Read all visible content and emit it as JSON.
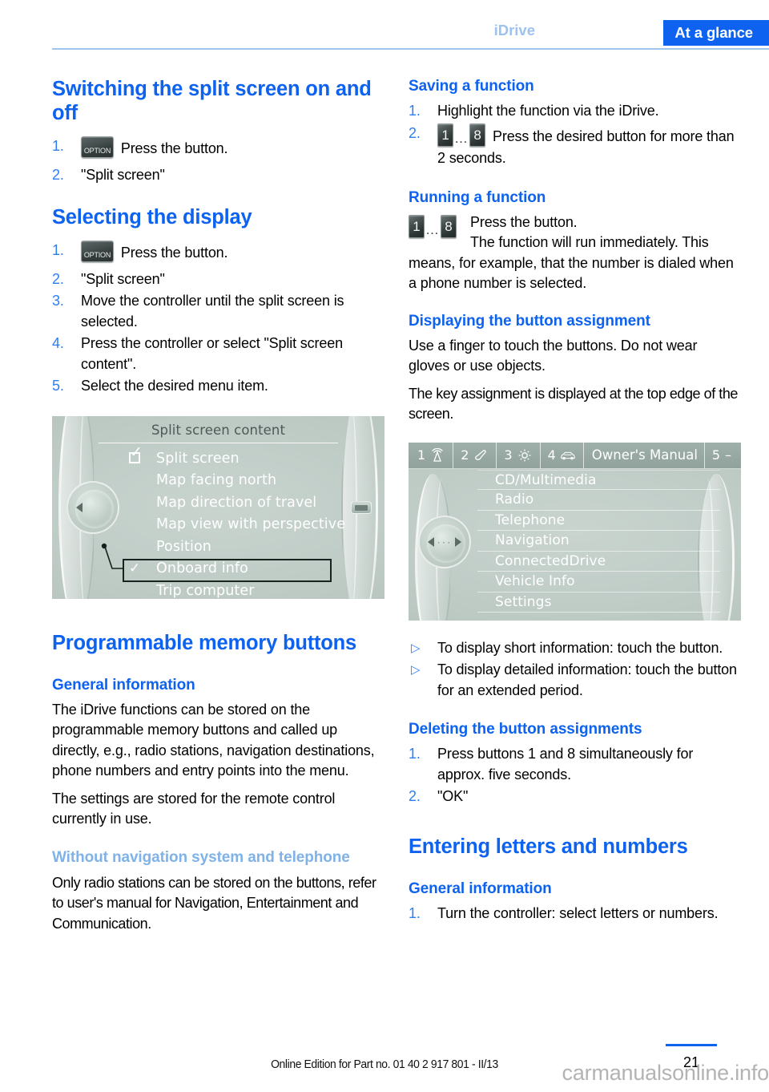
{
  "header": {
    "breadcrumb_left": "iDrive",
    "breadcrumb_active": "At a glance",
    "accent_blue": "#0d62ef",
    "light_blue": "#9cc2f2"
  },
  "left_column": {
    "section1_title": "Switching the split screen on and off",
    "section1_steps": [
      {
        "num": "1.",
        "icon": "option-button",
        "icon_label": "OPTION",
        "text": "Press the button."
      },
      {
        "num": "2.",
        "text": "\"Split screen\""
      }
    ],
    "section2_title": "Selecting the display",
    "section2_steps": [
      {
        "num": "1.",
        "icon": "option-button",
        "icon_label": "OPTION",
        "text": "Press the button."
      },
      {
        "num": "2.",
        "text": "\"Split screen\""
      },
      {
        "num": "3.",
        "text": "Move the controller until the split screen is selected."
      },
      {
        "num": "4.",
        "text": "Press the controller or select \"Split screen content\"."
      },
      {
        "num": "5.",
        "text": "Select the desired menu item."
      }
    ],
    "screenshot1": {
      "title": "Split screen content",
      "items": [
        {
          "label": "Split screen",
          "marker": "checkbox-checked"
        },
        {
          "label": "Map facing north",
          "marker": "none"
        },
        {
          "label": "Map direction of travel",
          "marker": "none"
        },
        {
          "label": "Map view with perspective",
          "marker": "none"
        },
        {
          "label": "Position",
          "marker": "none"
        },
        {
          "label": "Onboard info",
          "marker": "check",
          "selected": true
        },
        {
          "label": "Trip computer",
          "marker": "none"
        }
      ]
    },
    "section3_title": "Programmable memory buttons",
    "section3_sub1": "General information",
    "section3_p1": "The iDrive functions can be stored on the programmable memory buttons and called up directly, e.g., radio stations, navigation destinations, phone numbers and entry points into the menu.",
    "section3_p2": "The settings are stored for the remote control currently in use.",
    "section3_sub2": "Without navigation system and telephone",
    "section3_p3": "Only radio stations can be stored on the buttons, refer to user's manual for Navigation, Entertainment and Communication."
  },
  "right_column": {
    "section4_title": "Saving a function",
    "section4_steps": [
      {
        "num": "1.",
        "text": "Highlight the function via the iDrive."
      },
      {
        "num": "2.",
        "icon": "memory-buttons",
        "btn_from": "1",
        "btn_to": "8",
        "dots": "…",
        "text": "Press the desired button for more than 2 seconds."
      }
    ],
    "section5_title": "Running a function",
    "section5_btn_from": "1",
    "section5_btn_to": "8",
    "section5_dots": "…",
    "section5_line1": "Press the button.",
    "section5_line2": "The function will run immediately. This",
    "section5_rest": "means, for example, that the number is dialed when a phone number is selected.",
    "section6_title": "Displaying the button assignment",
    "section6_p1": "Use a finger to touch the buttons. Do not wear gloves or use objects.",
    "section6_p2": "The key assignment is displayed at the top edge of the screen.",
    "screenshot2": {
      "topbar": [
        {
          "num": "1",
          "icon": "antenna-icon"
        },
        {
          "num": "2",
          "icon": "phone-icon"
        },
        {
          "num": "3",
          "icon": "gear-icon"
        },
        {
          "num": "4",
          "icon": "car-icon"
        }
      ],
      "topbar_title": "Owner's Manual",
      "topbar_right_num": "5",
      "topbar_right_sym": "–",
      "rows": [
        "CD/Multimedia",
        "Radio",
        "Telephone",
        "Navigation",
        "ConnectedDrive",
        "Vehicle Info",
        "Settings"
      ]
    },
    "bullets": [
      "To display short information: touch the button.",
      "To display detailed information: touch the button for an extended period."
    ],
    "section7_title": "Deleting the button assignments",
    "section7_steps": [
      {
        "num": "1.",
        "text": "Press buttons 1 and 8 simultaneously for approx. five seconds."
      },
      {
        "num": "2.",
        "text": "\"OK\""
      }
    ],
    "section8_title": "Entering letters and numbers",
    "section8_sub": "General information",
    "section8_steps": [
      {
        "num": "1.",
        "text": "Turn the controller: select letters or numbers."
      }
    ]
  },
  "footer": {
    "edition": "Online Edition for Part no. 01 40 2 917 801 - II/13",
    "page_number": "21",
    "watermark": "carmanualsonline.info"
  }
}
